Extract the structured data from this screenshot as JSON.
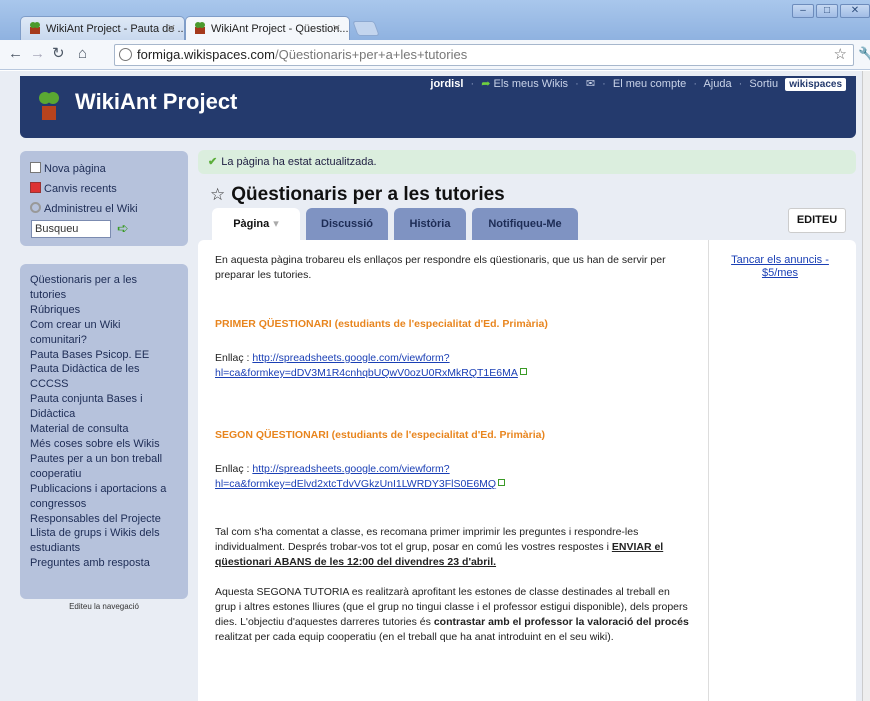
{
  "browser": {
    "tabs": [
      {
        "label": "WikiAnt Project - Pauta de ..."
      },
      {
        "label": "WikiAnt Project - Qüestion..."
      }
    ],
    "url_host": "formiga.wikispaces.com",
    "url_path": "/Qüestionaris+per+a+les+tutories"
  },
  "header": {
    "site_title": "WikiAnt Project",
    "username": "jordisl",
    "nav": [
      "Els meus Wikis",
      "El meu compte",
      "Ajuda",
      "Sortiu"
    ],
    "badge": "wikispaces"
  },
  "sidebar": {
    "actions": [
      {
        "label": "Nova pàgina"
      },
      {
        "label": "Canvis recents"
      },
      {
        "label": "Administreu el Wiki"
      }
    ],
    "search_value": "Busqueu",
    "nav_lines": [
      "Qüestionaris per a les",
      "tutories",
      "Rúbriques",
      "Com crear un Wiki",
      "comunitari?",
      "Pauta Bases Psicop. EE",
      "Pauta Didàctica de les",
      "CCCSS",
      "Pauta conjunta Bases i",
      "Didàctica",
      "Material de consulta",
      "Més coses sobre els Wikis",
      "Pautes per a un bon treball",
      "cooperatiu",
      "Publicacions i aportacions a",
      "congressos",
      "Responsables del Projecte",
      "Llista de grups i Wikis dels",
      "estudiants",
      "Preguntes amb resposta"
    ],
    "edit_nav": "Editeu la navegació"
  },
  "notice": "La pàgina ha estat actualitzada.",
  "page": {
    "title": "Qüestionaris per a les tutories",
    "tabs": [
      "Pàgina",
      "Discussió",
      "Història",
      "Notifiqueu-Me"
    ],
    "edit_button": "EDITEU"
  },
  "content": {
    "intro": "En aquesta pàgina trobareu els enllaços per respondre els qüestionaris, que us han de servir per preparar les tutories.",
    "q1_header": "PRIMER QÜESTIONARI (estudiants de l'especialitat d'Ed. Primària)",
    "link_label": "Enllaç :",
    "q1_link_a": "http://spreadsheets.google.com/viewform?",
    "q1_link_b": "hl=ca&formkey=dDV3M1R4cnhqbUQwV0ozU0RxMkRQT1E6MA",
    "q2_header": "SEGON QÜESTIONARI (estudiants de l'especialitat d'Ed. Primària)",
    "q2_link_a": "http://spreadsheets.google.com/viewform?",
    "q2_link_b": "hl=ca&formkey=dElvd2xtcTdvVGkzUnI1LWRDY3FlS0E6MQ",
    "p3_a": "Tal com s'ha comentat a classe, es recomana primer imprimir les preguntes i respondre-les individualment. Després trobar-vos tot el grup, posar en comú les vostres respostes i ",
    "p3_b": "ENVIAR el qüestionari ABANS de les 12:00 del divendres 23 d'abril.",
    "p4_a": "Aquesta SEGONA TUTORIA es realitzarà aprofitant les estones de classe destinades al treball en grup i altres estones lliures (que el grup no tingui classe i el professor estigui disponible), dels propers dies. L'objectiu d'aquestes darreres tutories és ",
    "p4_b": "contrastar amb el professor la valoració del procés",
    "p4_c": " realitzat per cada equip cooperatiu (en el treball que ha anat introduint en el seu wiki).",
    "ad_link": "Tancar els anuncis - $5/mes"
  }
}
